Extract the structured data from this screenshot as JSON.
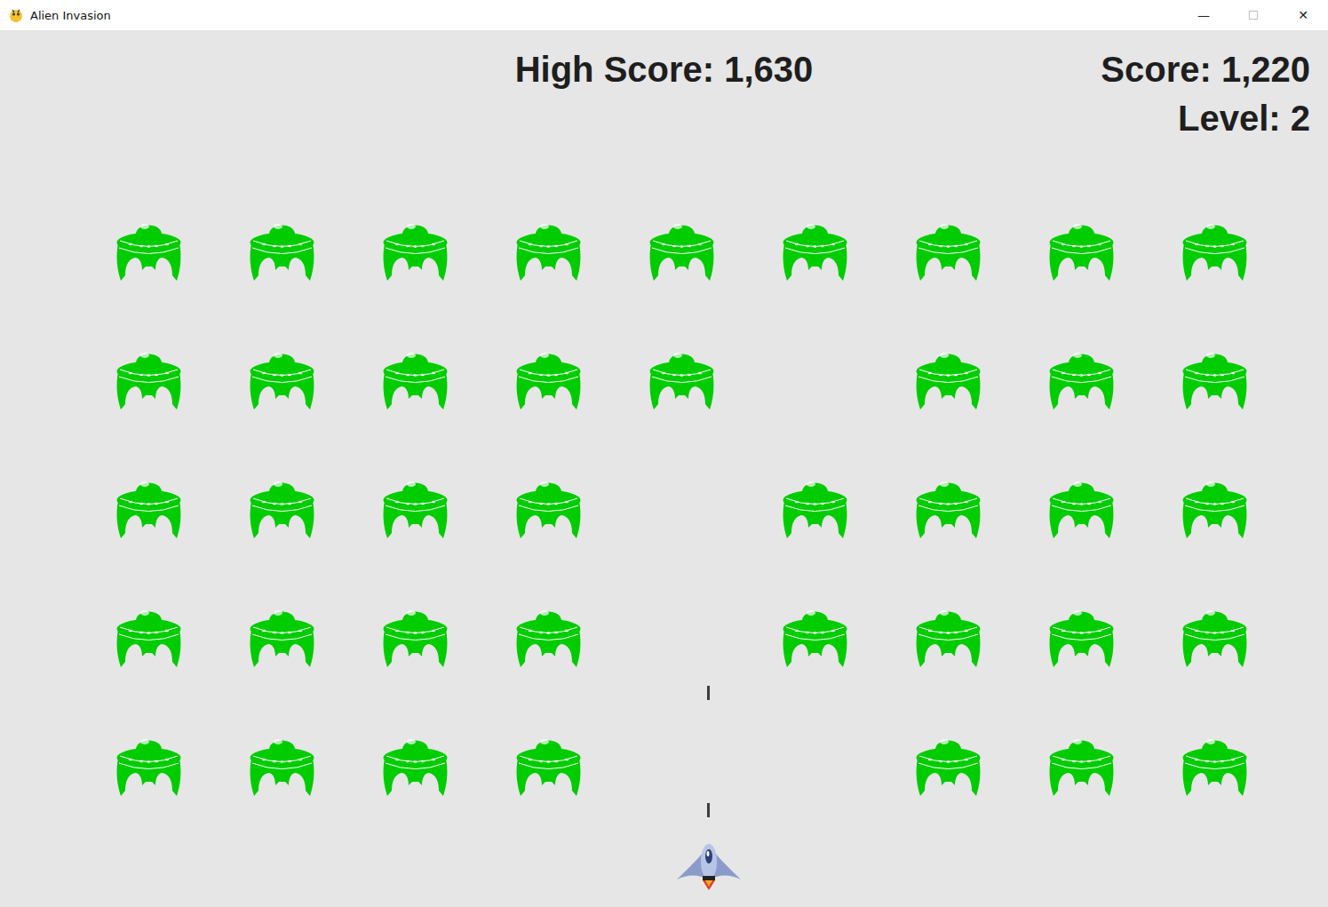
{
  "window": {
    "title": "Alien Invasion",
    "controls": [
      "—",
      "☐",
      "✕"
    ]
  },
  "scoreboard": {
    "high_score": "High Score: 1,630",
    "score": "Score: 1,220",
    "level": "Level: 2"
  },
  "fleet": [
    [
      {
        "alive": true
      },
      {
        "alive": true
      },
      {
        "alive": true
      },
      {
        "alive": true
      },
      {
        "alive": true
      },
      {
        "alive": true
      },
      {
        "alive": true
      },
      {
        "alive": true
      },
      {
        "alive": true
      }
    ],
    [
      {
        "alive": true
      },
      {
        "alive": true
      },
      {
        "alive": true
      },
      {
        "alive": true
      },
      {
        "alive": true
      },
      {
        "alive": false
      },
      {
        "alive": true
      },
      {
        "alive": true
      },
      {
        "alive": true
      }
    ],
    [
      {
        "alive": true
      },
      {
        "alive": true
      },
      {
        "alive": true
      },
      {
        "alive": true
      },
      {
        "alive": false
      },
      {
        "alive": true
      },
      {
        "alive": true
      },
      {
        "alive": true
      },
      {
        "alive": true
      }
    ],
    [
      {
        "alive": true
      },
      {
        "alive": true
      },
      {
        "alive": true
      },
      {
        "alive": true
      },
      {
        "alive": false
      },
      {
        "alive": true
      },
      {
        "alive": true
      },
      {
        "alive": true
      },
      {
        "alive": true
      }
    ],
    [
      {
        "alive": true
      },
      {
        "alive": true
      },
      {
        "alive": true
      },
      {
        "alive": true
      },
      {
        "alive": false
      },
      {
        "alive": false
      },
      {
        "alive": true
      },
      {
        "alive": true
      },
      {
        "alive": true
      }
    ]
  ],
  "bullets": 2
}
